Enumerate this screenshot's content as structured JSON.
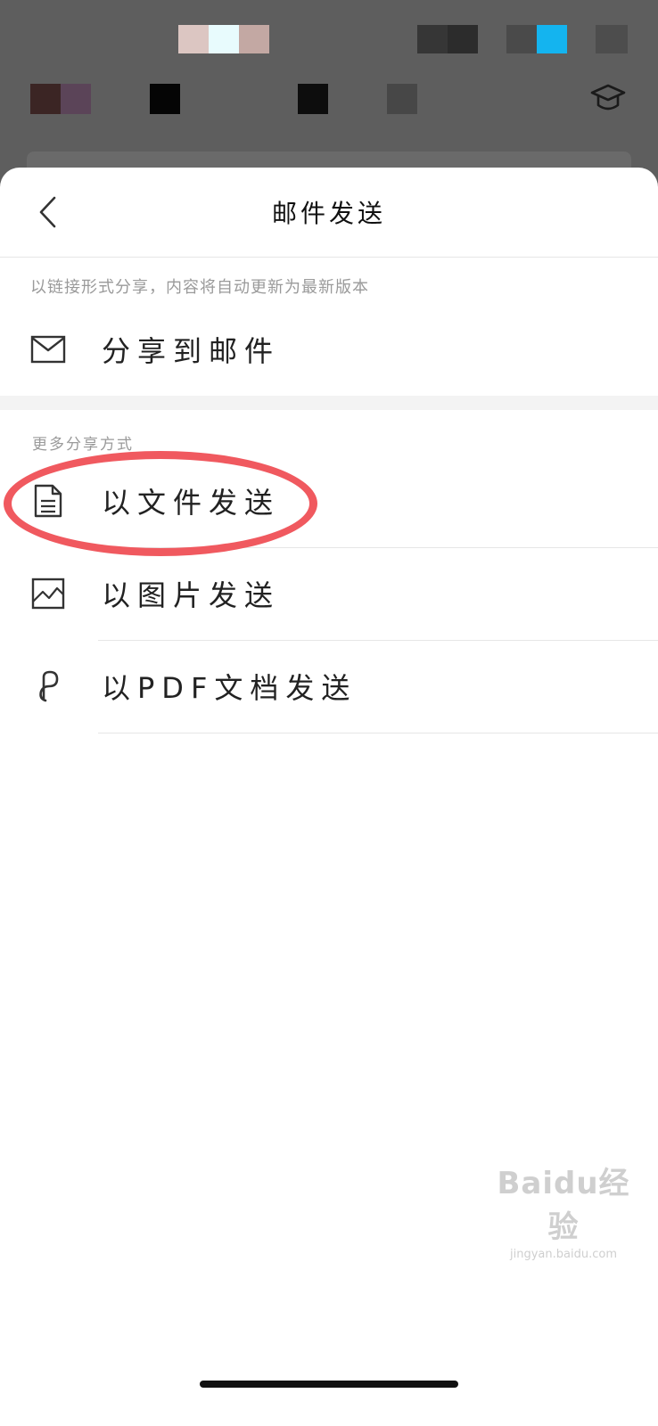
{
  "header": {
    "title": "邮件发送"
  },
  "share_email": {
    "hint": "以链接形式分享，内容将自动更新为最新版本",
    "label": "分享到邮件",
    "icon": "mail-icon"
  },
  "more_share": {
    "section_label": "更多分享方式",
    "items": [
      {
        "label": "以文件发送",
        "icon": "document-icon"
      },
      {
        "label": "以图片发送",
        "icon": "image-icon"
      },
      {
        "label": "以PDF文档发送",
        "icon": "pdf-icon"
      }
    ]
  },
  "annotation": {
    "color": "#f0595f",
    "target": "以文件发送"
  },
  "watermark": {
    "logo": "Baidu经验",
    "url": "jingyan.baidu.com"
  },
  "colors": {
    "backdrop": "#5e5e5e",
    "divider": "#e6e6e6",
    "hint_text": "#9a9a9a",
    "section_gap": "#f3f3f3"
  }
}
